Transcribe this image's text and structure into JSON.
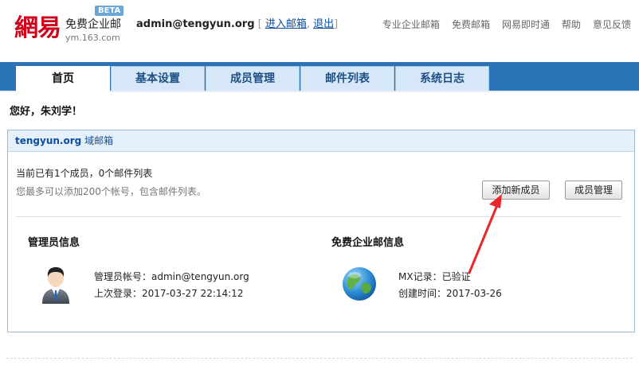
{
  "header": {
    "logo_main": "網易",
    "logo_sub": "免费企业邮",
    "logo_domain": "ym.163.com",
    "beta": "BETA",
    "account_user": "admin@tengyun.org",
    "enter_mailbox": "进入邮箱",
    "logout": "退出",
    "top_links": [
      "专业企业邮箱",
      "免费邮箱",
      "网易即时通",
      "帮助",
      "意见反馈"
    ]
  },
  "tabs": [
    "首页",
    "基本设置",
    "成员管理",
    "邮件列表",
    "系统日志"
  ],
  "greeting": "您好，朱刘学！",
  "panel": {
    "domain": "tengyun.org",
    "title_suffix": "域邮箱",
    "summary": "当前已有1个成员，0个邮件列表",
    "hint": "您最多可以添加200个帐号，包含邮件列表。",
    "add_member_button": "添加新成员",
    "member_manage_button": "成员管理"
  },
  "admin_info": {
    "title": "管理员信息",
    "account_line": "管理员帐号：admin@tengyun.org",
    "last_login_line": "上次登录：2017-03-27 22:14:12"
  },
  "mail_info": {
    "title": "免费企业邮信息",
    "mx_line": "MX记录：已验证",
    "created_line": "创建时间：2017-03-26"
  },
  "colors": {
    "brand_red": "#d0021b",
    "tab_bar": "#2b74b8",
    "link_blue": "#0c4da2",
    "annotation_red": "#e8262b"
  }
}
